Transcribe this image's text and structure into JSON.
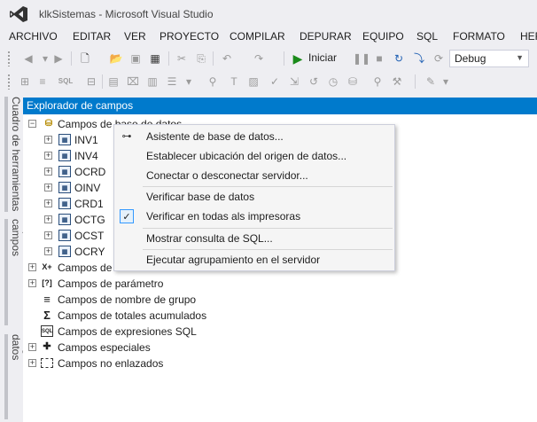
{
  "window": {
    "title": "klkSistemas - Microsoft Visual Studio"
  },
  "menubar": [
    "ARCHIVO",
    "EDITAR",
    "VER",
    "PROYECTO",
    "COMPILAR",
    "DEPURAR",
    "EQUIPO",
    "SQL",
    "FORMATO",
    "HERRAMIENTAS"
  ],
  "toolbar": {
    "run_label": "Iniciar",
    "run_icon": "play-icon",
    "configuration": "Debug",
    "sql_label": "SQL"
  },
  "side_tabs": [
    "Cuadro de herramientas",
    "Explorador de campos",
    "Orígenes de datos"
  ],
  "panel": {
    "title": "Explorador de campos"
  },
  "tree": {
    "root": "Campos de base de datos",
    "tables": [
      "INV1",
      "INV4",
      "OCRD",
      "OINV",
      "CRD1",
      "OCTG",
      "OCST",
      "OCRY"
    ],
    "icon_glyphs": {
      "formula": "X+",
      "parameter": "[?]",
      "group": "≡",
      "running": "Σ",
      "sql": "SQL",
      "special": "✚"
    },
    "items": [
      "Campos de fórmula",
      "Campos de parámetro",
      "Campos de nombre de grupo",
      "Campos de totales acumulados",
      "Campos de expresiones SQL",
      "Campos especiales",
      "Campos no enlazados"
    ]
  },
  "context_menu": {
    "items": [
      "Asistente de base de datos...",
      "Establecer ubicación del origen de datos...",
      "Conectar o desconectar servidor...",
      "Verificar base de datos",
      "Verificar en todas als impresoras",
      "Mostrar consulta de SQL...",
      "Ejecutar agrupamiento en el servidor"
    ],
    "checked_mark": "✓"
  },
  "colors": {
    "accent": "#007acc",
    "chrome": "#eeeef2",
    "menu_bg": "#f5f5f5"
  }
}
